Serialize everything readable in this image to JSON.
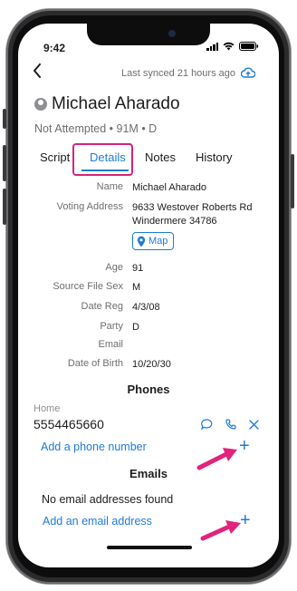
{
  "status_bar": {
    "time": "9:42"
  },
  "header": {
    "back_icon": "chevron-left-icon",
    "synced": "Last synced 21 hours ago",
    "sync_icon": "cloud-upload-icon"
  },
  "contact": {
    "name": "Michael Aharado",
    "summary": "Not Attempted • 91M • D"
  },
  "tabs": [
    {
      "label": "Script",
      "active": false
    },
    {
      "label": "Details",
      "active": true
    },
    {
      "label": "Notes",
      "active": false
    },
    {
      "label": "History",
      "active": false
    }
  ],
  "details": {
    "name_label": "Name",
    "name_value": "Michael Aharado",
    "address_label": "Voting Address",
    "address_line1": "9633 Westover Roberts Rd",
    "address_line2": "Windermere 34786",
    "map_label": "Map",
    "age_label": "Age",
    "age_value": "91",
    "sex_label": "Source File Sex",
    "sex_value": "M",
    "datereg_label": "Date Reg",
    "datereg_value": "4/3/08",
    "party_label": "Party",
    "party_value": "D",
    "email_label": "Email",
    "email_value": "",
    "dob_label": "Date of Birth",
    "dob_value": "10/20/30"
  },
  "phones": {
    "title": "Phones",
    "type_label": "Home",
    "number": "5554465660",
    "add_label": "Add a phone number",
    "plus": "+"
  },
  "emails": {
    "title": "Emails",
    "empty": "No email addresses found",
    "add_label": "Add an email address",
    "plus": "+"
  },
  "colors": {
    "accent": "#1f7bd8",
    "highlight": "#d6237d",
    "secondary_text": "#6e6e73"
  }
}
